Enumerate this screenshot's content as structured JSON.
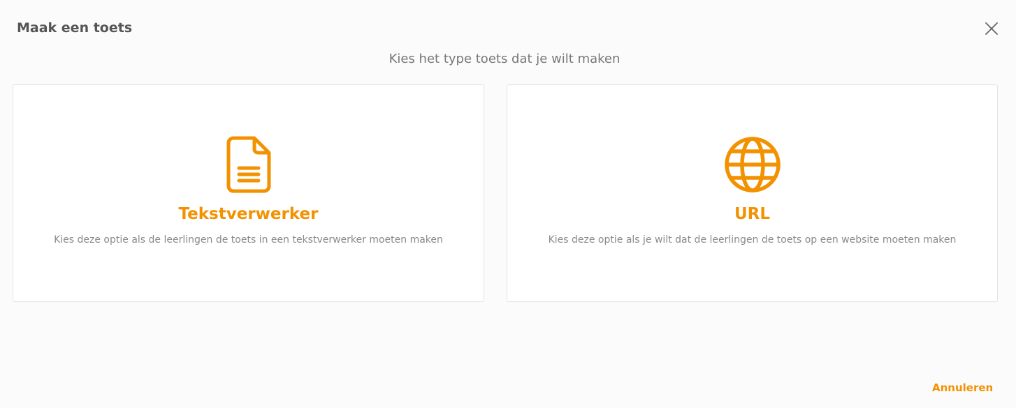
{
  "dialog": {
    "title": "Maak een toets",
    "subtitle": "Kies het type toets dat je wilt maken",
    "close_icon": "close-icon"
  },
  "options": [
    {
      "icon": "document-icon",
      "title": "Tekstverwerker",
      "description": "Kies deze optie als de leerlingen de toets in een tekstverwerker moeten maken"
    },
    {
      "icon": "globe-icon",
      "title": "URL",
      "description": "Kies deze optie als je wilt dat de leerlingen de toets op een website moeten maken"
    }
  ],
  "footer": {
    "cancel_label": "Annuleren"
  },
  "colors": {
    "accent": "#f39200",
    "title_text": "#555555",
    "muted_text": "#8a8a8a",
    "card_background": "#ffffff",
    "page_background": "#fbfbfb",
    "card_border": "#e3e3e3"
  }
}
